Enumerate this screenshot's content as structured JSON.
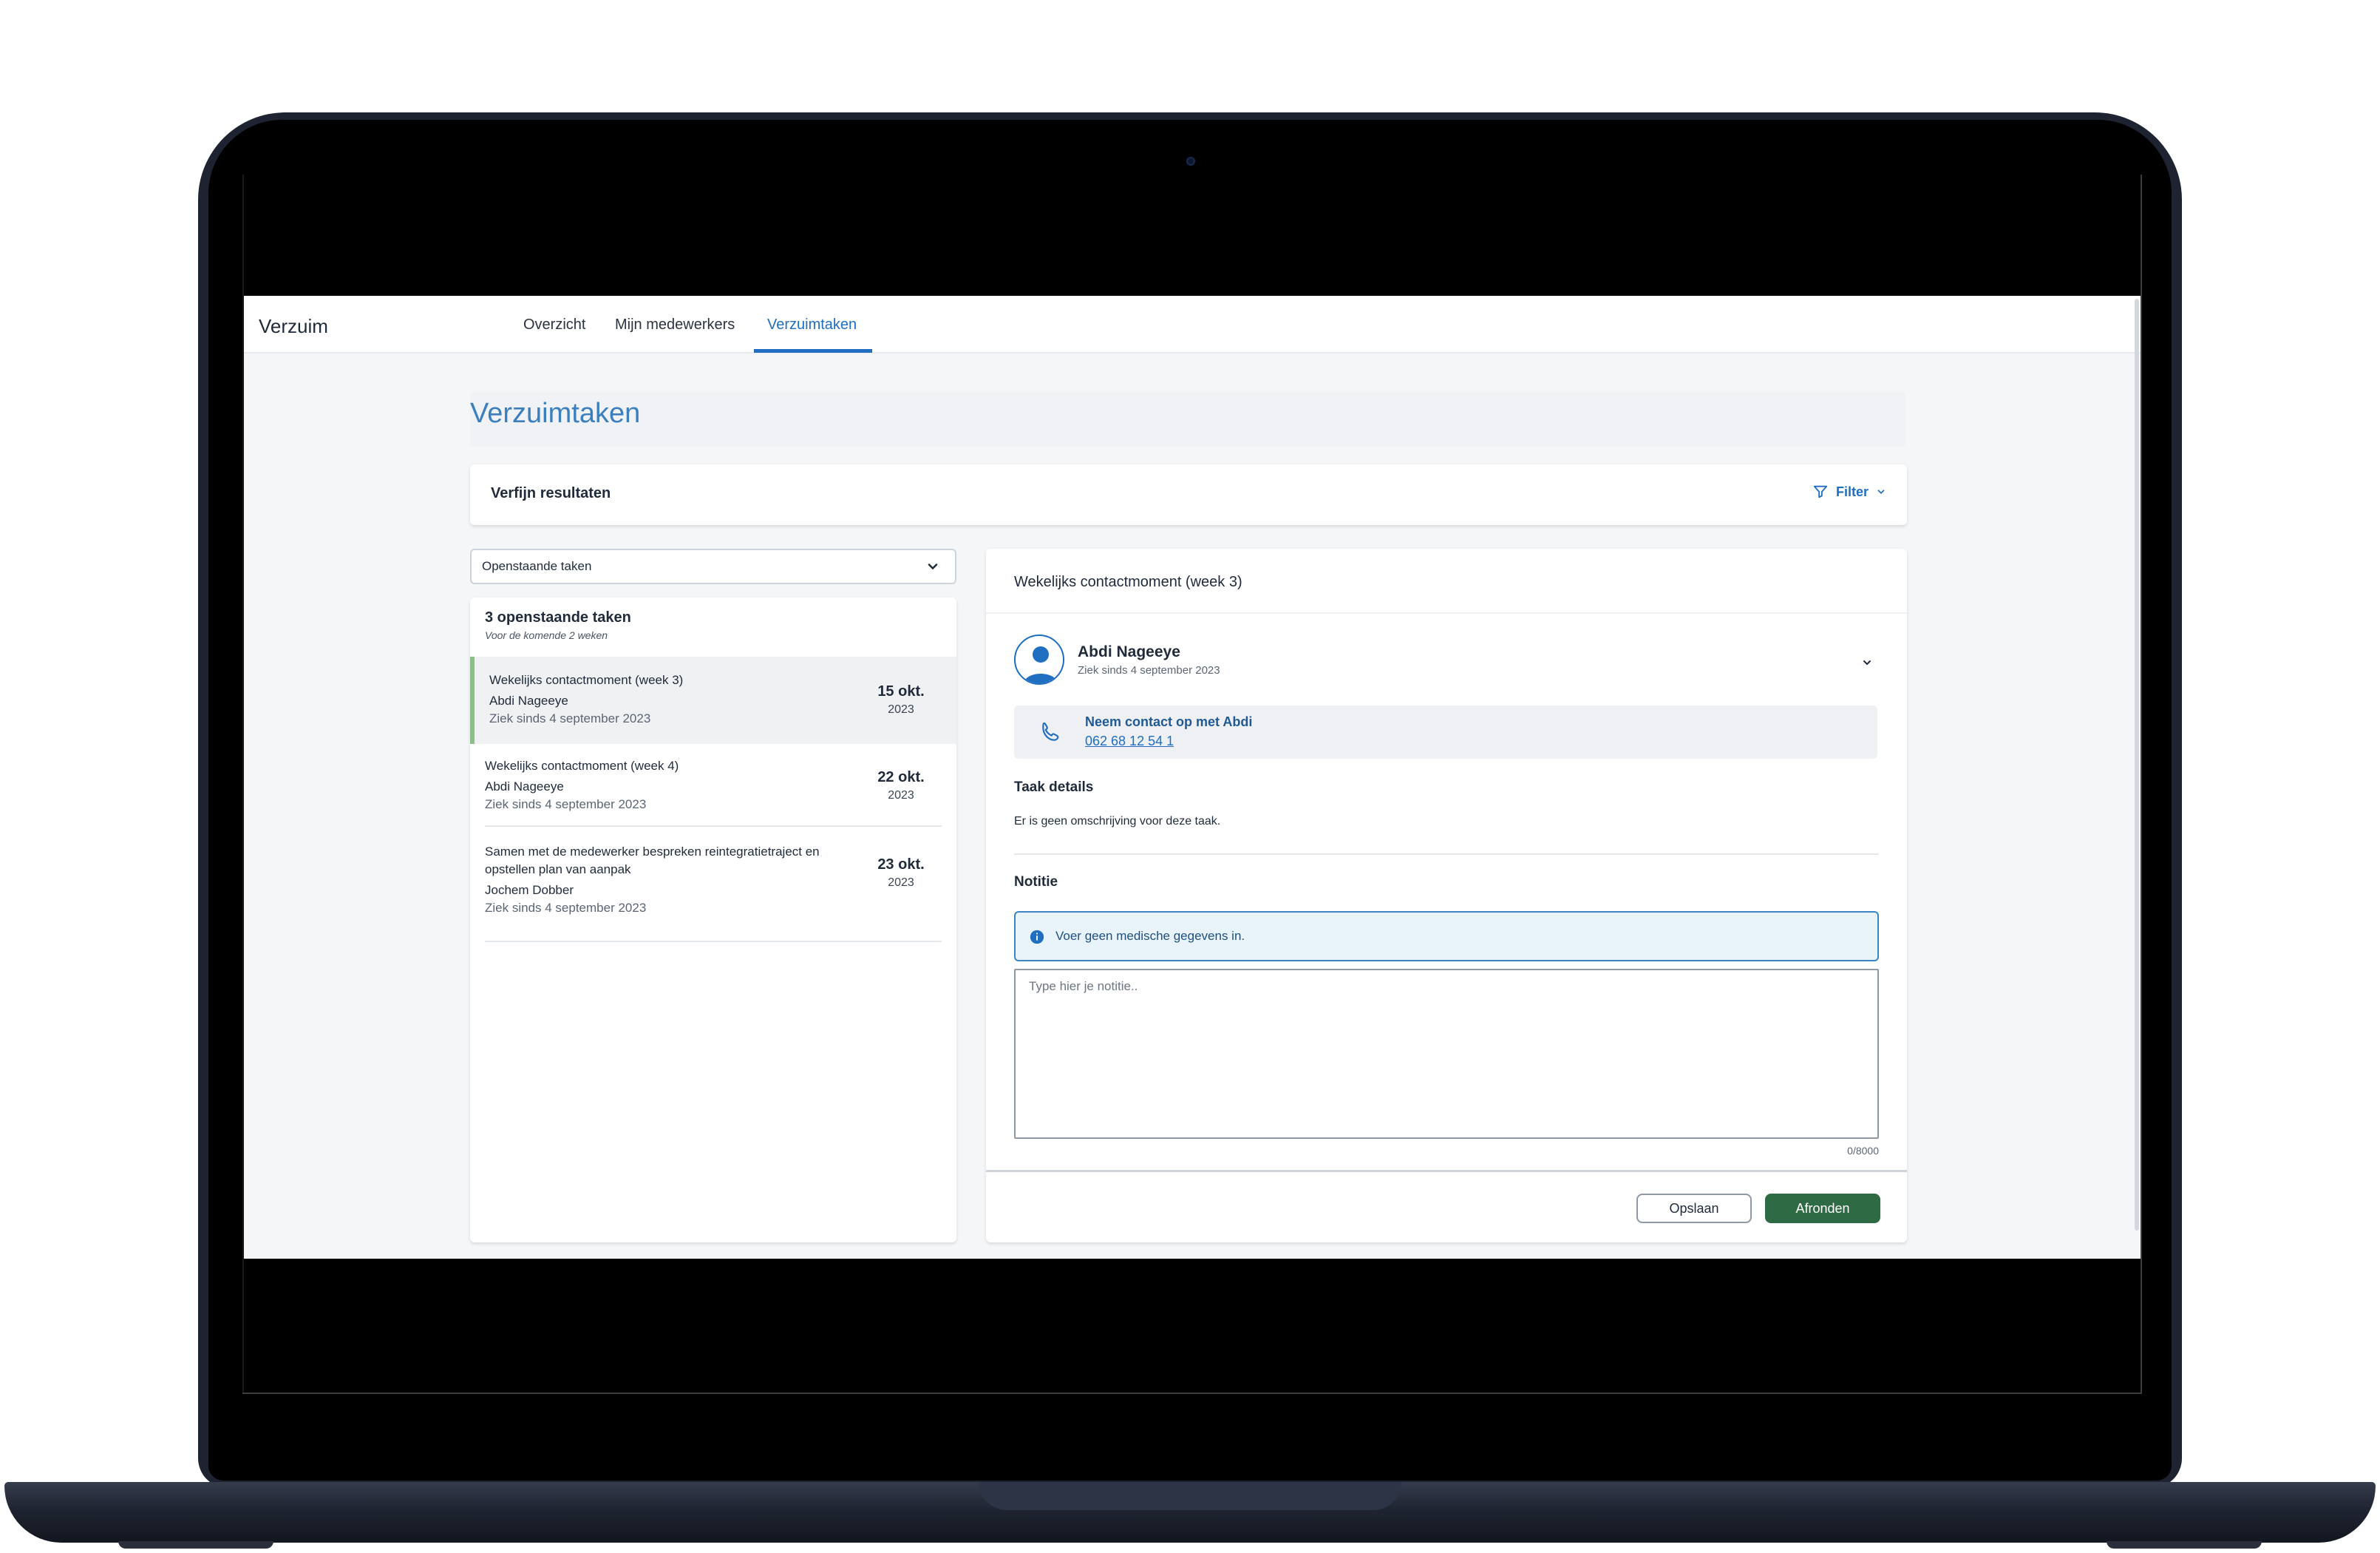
{
  "app": {
    "title": "Verzuim"
  },
  "nav": {
    "tabs": [
      {
        "label": "Overzicht"
      },
      {
        "label": "Mijn medewerkers"
      },
      {
        "label": "Verzuimtaken",
        "active": true
      }
    ]
  },
  "page": {
    "title": "Verzuimtaken"
  },
  "filter_bar": {
    "label": "Verfijn resultaten",
    "button_label": "Filter",
    "icon": "filter-icon"
  },
  "task_list": {
    "select_value": "Openstaande taken",
    "count_label": "3 openstaande taken",
    "sub_label": "Voor de komende 2 weken",
    "items": [
      {
        "title": "Wekelijks contactmoment (week 3)",
        "name": "Abdi Nageeye",
        "since": "Ziek sinds 4 september 2023",
        "date": "15 okt.",
        "year": "2023",
        "selected": true
      },
      {
        "title": "Wekelijks contactmoment (week 4)",
        "name": "Abdi Nageeye",
        "since": "Ziek sinds 4 september 2023",
        "date": "22 okt.",
        "year": "2023"
      },
      {
        "title": "Samen met de medewerker bespreken reintegratietraject en opstellen plan van aanpak",
        "name": "Jochem Dobber",
        "since": "Ziek sinds 4 september 2023",
        "date": "23 okt.",
        "year": "2023"
      }
    ]
  },
  "detail": {
    "title": "Wekelijks contactmoment (week 3)",
    "person": {
      "name": "Abdi Nageeye",
      "since": "Ziek sinds 4 september 2023"
    },
    "contact": {
      "label": "Neem contact op met Abdi",
      "phone": "062 68 12 54 1"
    },
    "task_details_label": "Taak details",
    "task_details_text": "Er is geen omschrijving voor deze taak.",
    "note_label": "Notitie",
    "info_text": "Voer geen medische gegevens in.",
    "note_placeholder": "Type hier je notitie..",
    "note_value": "",
    "counter": "0/8000",
    "save_label": "Opslaan",
    "finish_label": "Afronden"
  },
  "colors": {
    "accent": "#1f6ec0",
    "primary_button": "#2e6b44",
    "selected_indicator": "#8cbf8a",
    "info_background": "#e8f3fa",
    "laptop_frame": "#1e2331"
  }
}
